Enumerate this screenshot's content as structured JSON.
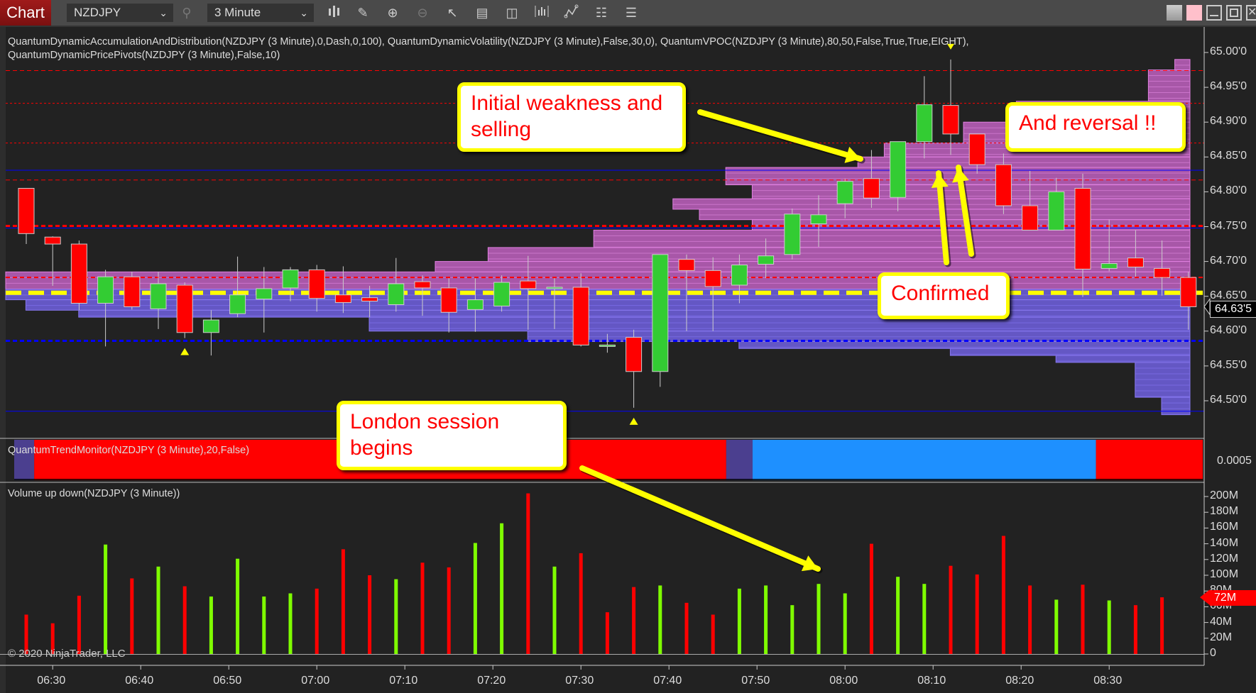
{
  "toolbar": {
    "tab_label": "Chart",
    "instrument": "NZDJPY",
    "interval": "3 Minute",
    "icons": [
      "search-icon",
      "bar-type-icon",
      "pencil-icon",
      "zoom-in-icon",
      "zoom-out-icon",
      "pointer-icon",
      "data-box-icon",
      "panel-layout-icon",
      "chart-style-icon",
      "indicators-icon",
      "strategy-icon",
      "properties-list-icon"
    ],
    "window_buttons": [
      "color-grey-button",
      "color-pink-button",
      "minimize-button",
      "maximize-button",
      "close-button"
    ]
  },
  "indicators": {
    "price_line1": "QuantumDynamicAccumulationAndDistribution(NZDJPY (3 Minute),0,Dash,0,100), QuantumDynamicVolatility(NZDJPY (3 Minute),False,30,0), QuantumVPOC(NZDJPY (3 Minute),80,50,False,True,True,EIGHT),",
    "price_line2": "QuantumDynamicPricePivots(NZDJPY (3 Minute),False,10)",
    "trend": "QuantumTrendMonitor(NZDJPY (3 Minute),20,False)",
    "volume": "Volume up down(NZDJPY (3 Minute))"
  },
  "callouts": {
    "weakness": "Initial weakness and selling",
    "reversal": "And reversal !!",
    "confirmed": "Confirmed",
    "london": "London session begins"
  },
  "copyright": "© 2020 NinjaTrader, LLC",
  "colors": {
    "up": "#33cc33",
    "down": "#ff0000",
    "vol_up": "#7fff00",
    "vol_down": "#ff0000",
    "profile_upper": "#c060c0",
    "profile_lower": "#7060e0",
    "vpoc": "#ffff00",
    "trend_bear": "#ff0000",
    "trend_neutral": "#4b3f8f",
    "trend_bull": "#1e90ff",
    "callout_border": "#ffff00",
    "callout_text": "#ff0000"
  },
  "chart_data": [
    {
      "type": "candlestick",
      "title": "NZDJPY (3 Minute)",
      "ylim": [
        64.47,
        65.02
      ],
      "y_ticks": [
        "65.00'0",
        "64.95'0",
        "64.90'0",
        "64.85'0",
        "64.80'0",
        "64.75'0",
        "64.70'0",
        "64.65'0",
        "64.60'0",
        "64.55'0",
        "64.50'0"
      ],
      "y_tick_values": [
        65.0,
        64.95,
        64.9,
        64.85,
        64.8,
        64.75,
        64.7,
        64.65,
        64.6,
        64.55,
        64.5
      ],
      "last_price_label": "64.63'5",
      "last_price": 64.635,
      "x_ticks": [
        "06:30",
        "06:40",
        "06:50",
        "07:00",
        "07:10",
        "07:20",
        "07:30",
        "07:40",
        "07:50",
        "08:00",
        "08:10",
        "08:20",
        "08:30"
      ],
      "first_bar_time": "06:27",
      "bar_minutes": 3,
      "candles": [
        {
          "o": 64.805,
          "h": 64.805,
          "l": 64.725,
          "c": 64.74
        },
        {
          "o": 64.735,
          "h": 64.736,
          "l": 64.665,
          "c": 64.725
        },
        {
          "o": 64.725,
          "h": 64.73,
          "l": 64.63,
          "c": 64.64
        },
        {
          "o": 64.64,
          "h": 64.688,
          "l": 64.578,
          "c": 64.678
        },
        {
          "o": 64.678,
          "h": 64.685,
          "l": 64.631,
          "c": 64.635
        },
        {
          "o": 64.632,
          "h": 64.685,
          "l": 64.603,
          "c": 64.668
        },
        {
          "o": 64.666,
          "h": 64.67,
          "l": 64.59,
          "c": 64.598
        },
        {
          "o": 64.598,
          "h": 64.63,
          "l": 64.565,
          "c": 64.616
        },
        {
          "o": 64.625,
          "h": 64.707,
          "l": 64.62,
          "c": 64.652
        },
        {
          "o": 64.646,
          "h": 64.692,
          "l": 64.598,
          "c": 64.661
        },
        {
          "o": 64.662,
          "h": 64.692,
          "l": 64.643,
          "c": 64.688
        },
        {
          "o": 64.688,
          "h": 64.695,
          "l": 64.628,
          "c": 64.647
        },
        {
          "o": 64.652,
          "h": 64.693,
          "l": 64.626,
          "c": 64.641
        },
        {
          "o": 64.648,
          "h": 64.665,
          "l": 64.62,
          "c": 64.643
        },
        {
          "o": 64.638,
          "h": 64.705,
          "l": 64.628,
          "c": 64.668
        },
        {
          "o": 64.671,
          "h": 64.68,
          "l": 64.622,
          "c": 64.662
        },
        {
          "o": 64.662,
          "h": 64.676,
          "l": 64.598,
          "c": 64.627
        },
        {
          "o": 64.631,
          "h": 64.676,
          "l": 64.599,
          "c": 64.645
        },
        {
          "o": 64.636,
          "h": 64.68,
          "l": 64.628,
          "c": 64.67
        },
        {
          "o": 64.672,
          "h": 64.708,
          "l": 64.602,
          "c": 64.661
        },
        {
          "o": 64.662,
          "h": 64.676,
          "l": 64.603,
          "c": 64.663
        },
        {
          "o": 64.663,
          "h": 64.683,
          "l": 64.578,
          "c": 64.58
        },
        {
          "o": 64.58,
          "h": 64.596,
          "l": 64.569,
          "c": 64.58
        },
        {
          "o": 64.591,
          "h": 64.602,
          "l": 64.49,
          "c": 64.542
        },
        {
          "o": 64.542,
          "h": 64.71,
          "l": 64.52,
          "c": 64.71
        },
        {
          "o": 64.703,
          "h": 64.71,
          "l": 64.6,
          "c": 64.687
        },
        {
          "o": 64.687,
          "h": 64.706,
          "l": 64.6,
          "c": 64.664
        },
        {
          "o": 64.666,
          "h": 64.71,
          "l": 64.64,
          "c": 64.695
        },
        {
          "o": 64.696,
          "h": 64.733,
          "l": 64.676,
          "c": 64.708
        },
        {
          "o": 64.71,
          "h": 64.776,
          "l": 64.703,
          "c": 64.768
        },
        {
          "o": 64.754,
          "h": 64.795,
          "l": 64.721,
          "c": 64.767
        },
        {
          "o": 64.783,
          "h": 64.819,
          "l": 64.762,
          "c": 64.815
        },
        {
          "o": 64.819,
          "h": 64.86,
          "l": 64.777,
          "c": 64.791
        },
        {
          "o": 64.792,
          "h": 64.872,
          "l": 64.772,
          "c": 64.872
        },
        {
          "o": 64.872,
          "h": 64.966,
          "l": 64.848,
          "c": 64.925
        },
        {
          "o": 64.924,
          "h": 64.99,
          "l": 64.853,
          "c": 64.883
        },
        {
          "o": 64.883,
          "h": 64.882,
          "l": 64.826,
          "c": 64.839
        },
        {
          "o": 64.839,
          "h": 64.855,
          "l": 64.768,
          "c": 64.78
        },
        {
          "o": 64.78,
          "h": 64.83,
          "l": 64.745,
          "c": 64.745
        },
        {
          "o": 64.745,
          "h": 64.82,
          "l": 64.745,
          "c": 64.8
        },
        {
          "o": 64.805,
          "h": 64.826,
          "l": 64.649,
          "c": 64.689
        },
        {
          "o": 64.69,
          "h": 64.76,
          "l": 64.686,
          "c": 64.697
        },
        {
          "o": 64.705,
          "h": 64.745,
          "l": 64.678,
          "c": 64.692
        },
        {
          "o": 64.69,
          "h": 64.73,
          "l": 64.651,
          "c": 64.677
        },
        {
          "o": 64.677,
          "h": 64.685,
          "l": 64.602,
          "c": 64.635
        }
      ],
      "pivot_markers": [
        {
          "bar": 6,
          "side": "low"
        },
        {
          "bar": 23,
          "side": "low"
        },
        {
          "bar": 35,
          "side": "high"
        }
      ],
      "levels": [
        {
          "price": 64.974,
          "color": "#ff0000",
          "style": "dash",
          "weight": "thin"
        },
        {
          "price": 64.927,
          "color": "#ff0000",
          "style": "dot",
          "weight": "thin"
        },
        {
          "price": 64.87,
          "color": "#ff0000",
          "style": "dot",
          "weight": "thin"
        },
        {
          "price": 64.831,
          "color": "#0000ff",
          "style": "solid",
          "weight": "thin"
        },
        {
          "price": 64.817,
          "color": "#ff0000",
          "style": "dash",
          "weight": "thin"
        },
        {
          "price": 64.751,
          "color": "#ff0000",
          "style": "dash",
          "weight": "thick"
        },
        {
          "price": 64.748,
          "color": "#0000ff",
          "style": "solid",
          "weight": "thin"
        },
        {
          "price": 64.677,
          "color": "#ff0000",
          "style": "dash",
          "weight": "medium"
        },
        {
          "price": 64.655,
          "color": "#ffff00",
          "style": "dash",
          "weight": "vpoc"
        },
        {
          "price": 64.586,
          "color": "#0000ff",
          "style": "dash",
          "weight": "thick"
        },
        {
          "price": 64.485,
          "color": "#0000ff",
          "style": "solid",
          "weight": "thin"
        }
      ],
      "volume_profile": {
        "vpoc": 64.655,
        "rows": [
          {
            "top": 64.99,
            "bottom": 64.975,
            "start_bar": 43.5,
            "zone": "upper"
          },
          {
            "top": 64.975,
            "bottom": 64.93,
            "start_bar": 42.5,
            "zone": "upper"
          },
          {
            "top": 64.93,
            "bottom": 64.9,
            "start_bar": 37.5,
            "zone": "upper"
          },
          {
            "top": 64.9,
            "bottom": 64.87,
            "start_bar": 35.5,
            "zone": "upper"
          },
          {
            "top": 64.87,
            "bottom": 64.85,
            "start_bar": 32.5,
            "zone": "upper"
          },
          {
            "top": 64.85,
            "bottom": 64.835,
            "start_bar": 31.5,
            "zone": "upper"
          },
          {
            "top": 64.835,
            "bottom": 64.81,
            "start_bar": 26.5,
            "zone": "upper"
          },
          {
            "top": 64.81,
            "bottom": 64.79,
            "start_bar": 27.5,
            "zone": "upper"
          },
          {
            "top": 64.79,
            "bottom": 64.775,
            "start_bar": 24.5,
            "zone": "upper"
          },
          {
            "top": 64.775,
            "bottom": 64.76,
            "start_bar": 25.5,
            "zone": "upper"
          },
          {
            "top": 64.76,
            "bottom": 64.745,
            "start_bar": 27.5,
            "zone": "upper"
          },
          {
            "top": 64.745,
            "bottom": 64.72,
            "start_bar": 21.5,
            "zone": "upper"
          },
          {
            "top": 64.72,
            "bottom": 64.7,
            "start_bar": 17.5,
            "zone": "upper"
          },
          {
            "top": 64.7,
            "bottom": 64.685,
            "start_bar": 15.5,
            "zone": "upper"
          },
          {
            "top": 64.685,
            "bottom": 64.66,
            "start_bar": -1,
            "zone": "upper"
          },
          {
            "top": 64.66,
            "bottom": 64.645,
            "start_bar": -1,
            "zone": "lower"
          },
          {
            "top": 64.645,
            "bottom": 64.63,
            "start_bar": 0,
            "zone": "lower"
          },
          {
            "top": 64.63,
            "bottom": 64.62,
            "start_bar": 2,
            "zone": "lower"
          },
          {
            "top": 64.62,
            "bottom": 64.6,
            "start_bar": 13,
            "zone": "lower"
          },
          {
            "top": 64.6,
            "bottom": 64.585,
            "start_bar": 19,
            "zone": "lower"
          },
          {
            "top": 64.585,
            "bottom": 64.575,
            "start_bar": 27,
            "zone": "lower"
          },
          {
            "top": 64.575,
            "bottom": 64.565,
            "start_bar": 35,
            "zone": "lower"
          },
          {
            "top": 64.565,
            "bottom": 64.555,
            "start_bar": 39,
            "zone": "lower"
          },
          {
            "top": 64.555,
            "bottom": 64.505,
            "start_bar": 42,
            "zone": "lower"
          },
          {
            "top": 64.505,
            "bottom": 64.48,
            "start_bar": 43,
            "zone": "lower"
          }
        ]
      }
    },
    {
      "type": "bar",
      "title": "QuantumTrendMonitor(NZDJPY (3 Minute),20,False)",
      "y_tick": "0.0005",
      "segments": [
        {
          "state": "neutral",
          "from_bar": -0.5,
          "to_bar": 0.3
        },
        {
          "state": "bear",
          "from_bar": 0.3,
          "to_bar": 26.5
        },
        {
          "state": "neutral",
          "from_bar": 26.5,
          "to_bar": 27.5
        },
        {
          "state": "bull",
          "from_bar": 27.5,
          "to_bar": 40.5
        },
        {
          "state": "bear",
          "from_bar": 40.5,
          "to_bar": 45
        }
      ]
    },
    {
      "type": "bar",
      "title": "Volume up down(NZDJPY (3 Minute))",
      "ylim": [
        0,
        210
      ],
      "y_unit": "M",
      "y_ticks": [
        "200M",
        "180M",
        "160M",
        "140M",
        "120M",
        "100M",
        "80M",
        "60M",
        "40M",
        "20M",
        "0"
      ],
      "y_tick_values": [
        200,
        180,
        160,
        140,
        120,
        100,
        80,
        60,
        40,
        20,
        0
      ],
      "last_value_label": "72M",
      "values": [
        50,
        39,
        74,
        139,
        96,
        111,
        86,
        73,
        121,
        73,
        77,
        83,
        133,
        100,
        95,
        116,
        110,
        141,
        166,
        204,
        111,
        128,
        53,
        85,
        87,
        65,
        50,
        83,
        87,
        62,
        89,
        77,
        140,
        98,
        89,
        112,
        101,
        150,
        87,
        69,
        88,
        68,
        62,
        72
      ],
      "directions": [
        "down",
        "down",
        "down",
        "up",
        "down",
        "up",
        "down",
        "up",
        "up",
        "up",
        "up",
        "down",
        "down",
        "down",
        "up",
        "down",
        "down",
        "up",
        "up",
        "down",
        "up",
        "down",
        "down",
        "down",
        "up",
        "down",
        "down",
        "up",
        "up",
        "up",
        "up",
        "up",
        "down",
        "up",
        "up",
        "down",
        "down",
        "down",
        "down",
        "up",
        "down",
        "up",
        "down",
        "down"
      ]
    }
  ]
}
